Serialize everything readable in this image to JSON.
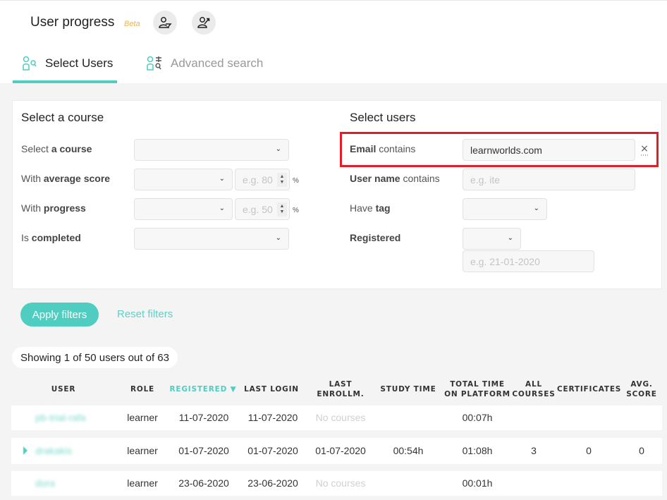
{
  "header": {
    "title": "User progress",
    "badge": "Beta",
    "actions": [
      {
        "icon": "user-filter-icon"
      },
      {
        "icon": "user-progress-icon"
      }
    ]
  },
  "tabs": [
    {
      "label": "Select Users",
      "icon": "users-search-icon",
      "active": true
    },
    {
      "label": "Advanced search",
      "icon": "users-advanced-search-icon",
      "active": false
    }
  ],
  "course_filters": {
    "title": "Select a course",
    "select_course": {
      "label_plain": "Select ",
      "label_bold": "a course",
      "value": ""
    },
    "average_score": {
      "label_plain": "With ",
      "label_bold": "average score",
      "value": "",
      "placeholder": "e.g. 80",
      "unit": "%"
    },
    "progress": {
      "label_plain": "With ",
      "label_bold": "progress",
      "value": "",
      "placeholder": "e.g. 50",
      "unit": "%"
    },
    "completed": {
      "label_plain": "Is ",
      "label_bold": "completed",
      "value": ""
    }
  },
  "user_filters": {
    "title": "Select users",
    "email": {
      "label_bold": "Email",
      "label_plain": " contains",
      "value": "learnworlds.com",
      "clear": "×"
    },
    "username": {
      "label_bold": "User name",
      "label_plain": " contains",
      "placeholder": "e.g. ite"
    },
    "tag": {
      "label_plain": "Have ",
      "label_bold": "tag",
      "value": ""
    },
    "registered": {
      "label_bold": "Registered",
      "value": "",
      "date_placeholder": "e.g. 21-01-2020"
    }
  },
  "buttons": {
    "apply": "Apply filters",
    "reset": "Reset filters"
  },
  "summary": "Showing 1 of 50 users out of 63",
  "table": {
    "columns": [
      {
        "key": "user",
        "label": "USER"
      },
      {
        "key": "role",
        "label": "ROLE"
      },
      {
        "key": "registered",
        "label": "REGISTERED ▼",
        "sorted": true
      },
      {
        "key": "last_login",
        "label": "LAST LOGIN"
      },
      {
        "key": "last_enroll_1",
        "label": "LAST"
      },
      {
        "key": "last_enroll_2",
        "label": "ENROLLM."
      },
      {
        "key": "study_time",
        "label": "STUDY TIME"
      },
      {
        "key": "total_time_1",
        "label": "TOTAL TIME"
      },
      {
        "key": "total_time_2",
        "label": "ON PLATFORM"
      },
      {
        "key": "all_courses_1",
        "label": "ALL"
      },
      {
        "key": "all_courses_2",
        "label": "COURSES"
      },
      {
        "key": "certificates",
        "label": "CERTIFICATES"
      },
      {
        "key": "avg_score_1",
        "label": "AVG."
      },
      {
        "key": "avg_score_2",
        "label": "SCORE"
      }
    ],
    "rows": [
      {
        "user": "pb-trial-rafa",
        "role": "learner",
        "registered": "11-07-2020",
        "last_login": "11-07-2020",
        "last_enrollment": "No courses",
        "study_time": "",
        "total_time": "00:07h",
        "all_courses": "",
        "certificates": "",
        "avg_score": ""
      },
      {
        "user": "drakakis",
        "role": "learner",
        "registered": "01-07-2020",
        "last_login": "01-07-2020",
        "last_enrollment": "01-07-2020",
        "study_time": "00:54h",
        "total_time": "01:08h",
        "all_courses": "3",
        "certificates": "0",
        "avg_score": "0"
      },
      {
        "user": "dora",
        "role": "learner",
        "registered": "23-06-2020",
        "last_login": "23-06-2020",
        "last_enrollment": "No courses",
        "study_time": "",
        "total_time": "00:01h",
        "all_courses": "",
        "certificates": "",
        "avg_score": ""
      }
    ]
  },
  "colors": {
    "accent": "#4ecdc0",
    "beta": "#f0b24a",
    "highlight": "#e21f26"
  }
}
